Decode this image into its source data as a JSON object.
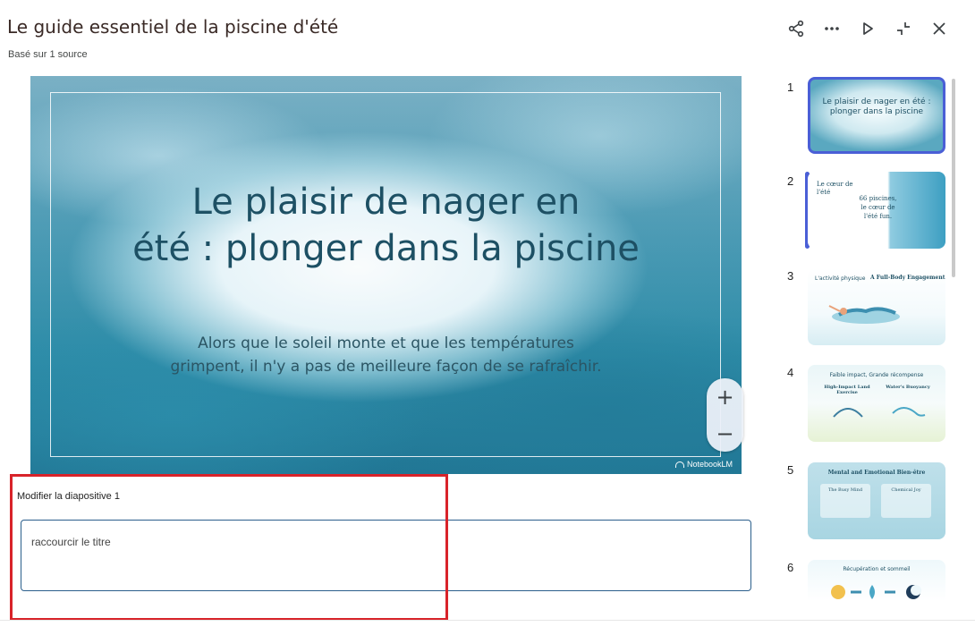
{
  "header": {
    "title": "Le guide essentiel de la piscine d'été",
    "subtitle": "Basé sur 1 source"
  },
  "toolbar": {
    "share_icon": "share-icon",
    "more_icon": "more-horizontal-icon",
    "play_icon": "play-icon",
    "collapse_icon": "collapse-icon",
    "close_icon": "close-icon"
  },
  "slide": {
    "title_line1": "Le plaisir de nager en",
    "title_line2": "été : plonger dans la piscine",
    "body_line1": "Alors que le soleil monte et que les températures",
    "body_line2": "grimpent, il n'y a pas de meilleure façon de se rafraîchir.",
    "brand": "NotebookLM"
  },
  "zoom": {
    "plus": "+",
    "minus": "−"
  },
  "editor": {
    "label": "Modifier la diapositive 1",
    "value": "raccourcir le titre"
  },
  "thumbnails": [
    {
      "number": "1",
      "title": "Le plaisir de nager en été : plonger dans la piscine",
      "selected": true
    },
    {
      "number": "2",
      "title": "Le cœur de l'été",
      "caption": "66 piscines, le cœur de l'été fun."
    },
    {
      "number": "3",
      "title": "L'activité physique",
      "heading": "A Full-Body Engagement"
    },
    {
      "number": "4",
      "title": "Faible impact, Grande récompense",
      "left": "High-Impact Land Exercise",
      "right": "Water's Buoyancy"
    },
    {
      "number": "5",
      "title": "Mental and Emotional Bien-être",
      "left": "The Busy Mind",
      "right": "Chemical Joy"
    },
    {
      "number": "6",
      "title": "Récupération et sommeil"
    }
  ],
  "colors": {
    "accent": "#4a5fd6",
    "highlight": "#d8232a",
    "input_border": "#2b5f8c"
  }
}
